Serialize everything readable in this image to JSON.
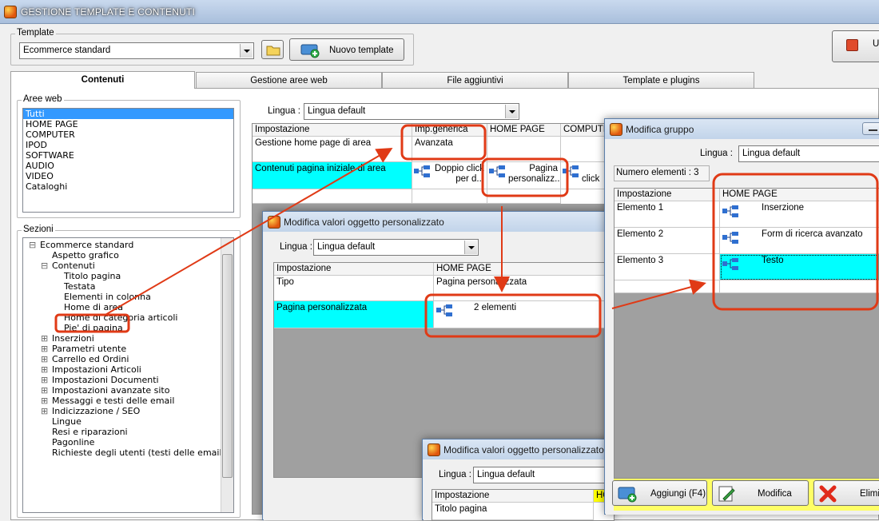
{
  "app": {
    "title": "GESTIONE TEMPLATE E CONTENUTI"
  },
  "template_group": {
    "label": "Template",
    "selected": "Ecommerce standard",
    "new_button": "Nuovo template",
    "exit_partial": "U"
  },
  "tabs": [
    {
      "label": "Contenuti",
      "active": true
    },
    {
      "label": "Gestione aree web"
    },
    {
      "label": "File aggiuntivi"
    },
    {
      "label": "Template e plugins"
    }
  ],
  "aree_web": {
    "label": "Aree web",
    "items": [
      "Tutti",
      "HOME PAGE",
      "COMPUTER",
      "IPOD",
      "SOFTWARE",
      "AUDIO",
      "VIDEO",
      "Cataloghi"
    ],
    "selected_index": 0
  },
  "sezioni": {
    "label": "Sezioni",
    "items": [
      {
        "label": "Ecommerce standard",
        "level": 0,
        "toggle": "⊟"
      },
      {
        "label": "Aspetto grafico",
        "level": 1,
        "toggle": ""
      },
      {
        "label": "Contenuti",
        "level": 1,
        "toggle": "⊟"
      },
      {
        "label": "Titolo pagina",
        "level": 2,
        "toggle": ""
      },
      {
        "label": "Testata",
        "level": 2,
        "toggle": ""
      },
      {
        "label": "Elementi in colonna",
        "level": 2,
        "toggle": ""
      },
      {
        "label": "Home di area",
        "level": 2,
        "toggle": ""
      },
      {
        "label": "Home di categoria articoli",
        "level": 2,
        "toggle": ""
      },
      {
        "label": "Pie' di pagina",
        "level": 2,
        "toggle": ""
      },
      {
        "label": "Inserzioni",
        "level": 1,
        "toggle": "⊞"
      },
      {
        "label": "Parametri utente",
        "level": 1,
        "toggle": "⊞"
      },
      {
        "label": "Carrello ed Ordini",
        "level": 1,
        "toggle": "⊞"
      },
      {
        "label": "Impostazioni Articoli",
        "level": 1,
        "toggle": "⊞"
      },
      {
        "label": "Impostazioni Documenti",
        "level": 1,
        "toggle": "⊞"
      },
      {
        "label": "Impostazioni avanzate sito",
        "level": 1,
        "toggle": "⊞"
      },
      {
        "label": "Messaggi e testi delle email",
        "level": 1,
        "toggle": "⊞"
      },
      {
        "label": "Indicizzazione / SEO",
        "level": 1,
        "toggle": "⊞"
      },
      {
        "label": "Lingue",
        "level": 1,
        "toggle": ""
      },
      {
        "label": "Resi e riparazioni",
        "level": 1,
        "toggle": ""
      },
      {
        "label": "Pagonline",
        "level": 1,
        "toggle": ""
      },
      {
        "label": "Richieste degli utenti (testi delle email)",
        "level": 1,
        "toggle": ""
      }
    ]
  },
  "main": {
    "lingua_label": "Lingua :",
    "lingua_value": "Lingua default",
    "headers": [
      "Impostazione",
      "Imp.generica",
      "HOME PAGE",
      "COMPUTE"
    ],
    "row1": {
      "label": "Gestione home page di area",
      "generic": "Avanzata"
    },
    "row2": {
      "label": "Contenuti pagina iniziale di area",
      "generic": "Doppio click per d...",
      "home": "Pagina personalizz...",
      "computer": "click"
    }
  },
  "dialog1": {
    "title": "Modifica valori oggetto personalizzato",
    "lingua_label": "Lingua :",
    "lingua_value": "Lingua default",
    "headers": [
      "Impostazione",
      "HOME PAGE"
    ],
    "row1": {
      "label": "Tipo",
      "value": "Pagina personalizzata"
    },
    "row2": {
      "label": "Pagina personalizzata",
      "value": "2 elementi"
    }
  },
  "dialog2": {
    "title": "Modifica valori oggetto personalizzato",
    "lingua_label": "Lingua :",
    "lingua_value": "Lingua default",
    "headers": [
      "Impostazione",
      "HO"
    ],
    "row1": {
      "label": "Titolo pagina"
    }
  },
  "dialog3": {
    "title": "Modifica gruppo",
    "lingua_label": "Lingua :",
    "lingua_value": "Lingua default",
    "count": "Numero elementi : 3",
    "headers": [
      "Impostazione",
      "HOME PAGE"
    ],
    "rows": [
      {
        "label": "Elemento 1",
        "value": "Inserzione"
      },
      {
        "label": "Elemento 2",
        "value": "Form di ricerca avanzato"
      },
      {
        "label": "Elemento 3",
        "value": "Testo"
      }
    ],
    "buttons": {
      "add": "Aggiungi (F4)",
      "edit": "Modifica",
      "delete": "Elimi"
    }
  },
  "colors": {
    "accent_red": "#e03a16",
    "cyan": "#00ffff",
    "selection": "#3399ff"
  }
}
